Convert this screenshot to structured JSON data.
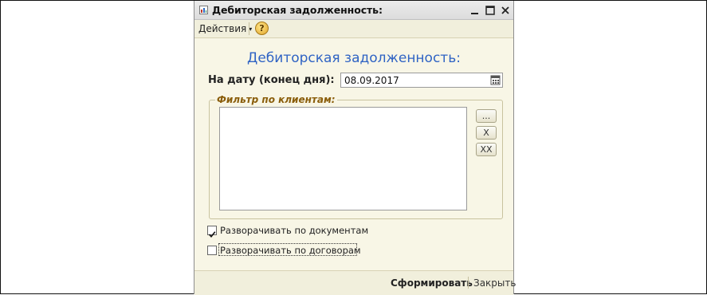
{
  "window": {
    "title": "Дебиторская задолженность:",
    "icon": "report-icon"
  },
  "toolbar": {
    "actions_label": "Действия",
    "actions_arrow": "▾",
    "help_label": "?"
  },
  "form": {
    "title": "Дебиторская задолженность:",
    "date_label": "На дату (конец дня):",
    "date_value": "08.09.2017",
    "filter_legend": "Фильтр по клиентам:",
    "filter_buttons": {
      "select": "...",
      "clear": "X",
      "clear_all": "XX"
    },
    "checkbox_documents": {
      "label": "Разворачивать  по документам",
      "checked": true
    },
    "checkbox_contracts": {
      "label": "Разворачивать  по договорам",
      "checked": false
    }
  },
  "footer": {
    "run_label": "Сформировать",
    "close_label": "Закрыть"
  }
}
